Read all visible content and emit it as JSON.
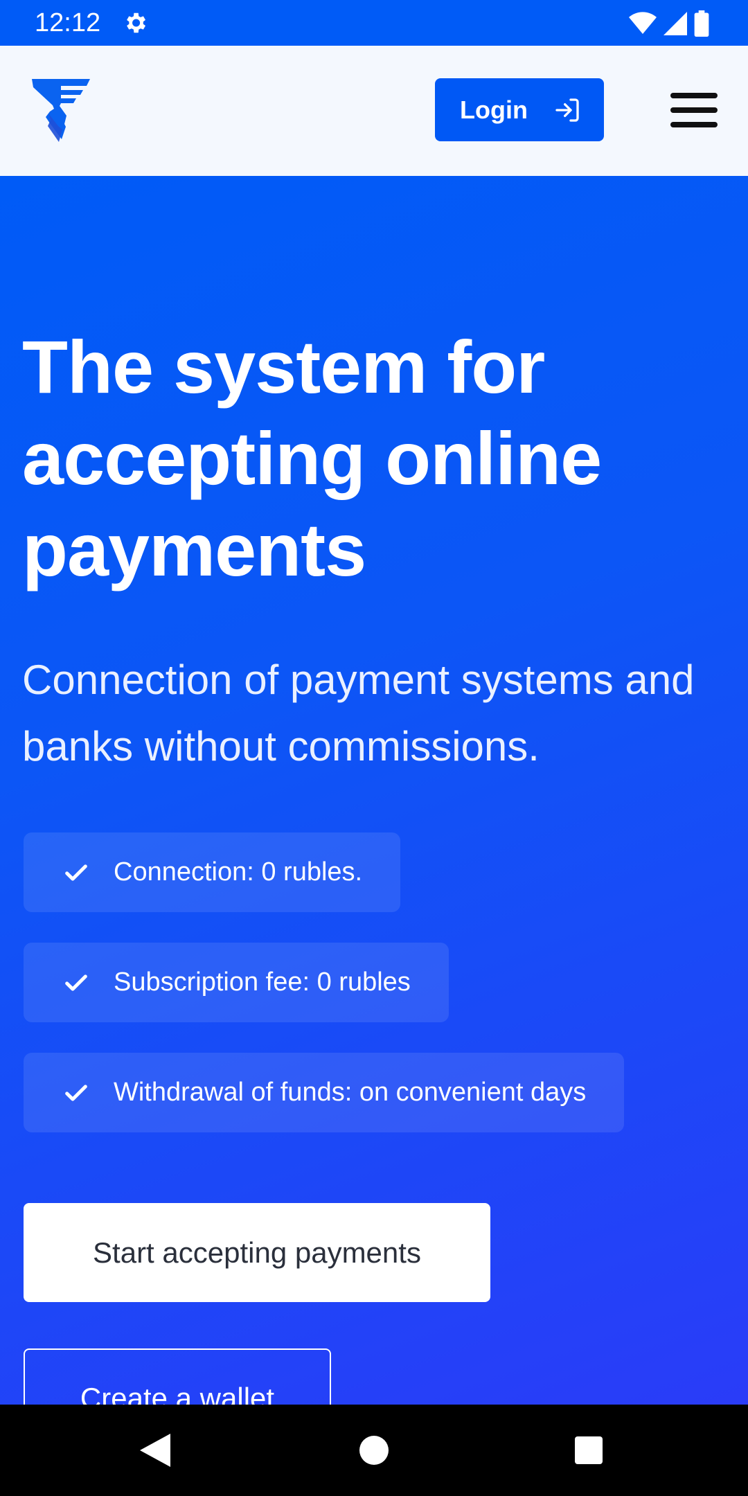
{
  "status_bar": {
    "time": "12:12",
    "icons": [
      "gear-icon",
      "wifi-icon",
      "signal-icon",
      "battery-icon"
    ]
  },
  "header": {
    "login_label": "Login",
    "icons": [
      "logo-icon",
      "login-icon",
      "menu-icon"
    ]
  },
  "hero": {
    "title": "The system for accepting online payments",
    "subtitle": "Connection of payment systems and banks without commissions.",
    "features": [
      "Connection: 0 rubles.",
      "Subscription fee: 0 rubles",
      "Withdrawal of funds: on convenient days"
    ],
    "primary_cta": "Start accepting payments",
    "secondary_cta": "Create a wallet"
  },
  "nav_bar": {
    "icons": [
      "back-icon",
      "home-icon",
      "recents-icon"
    ]
  },
  "colors": {
    "brand_blue": "#005BF7",
    "header_bg": "#F4F8FE",
    "text_white": "#FFFFFF"
  }
}
